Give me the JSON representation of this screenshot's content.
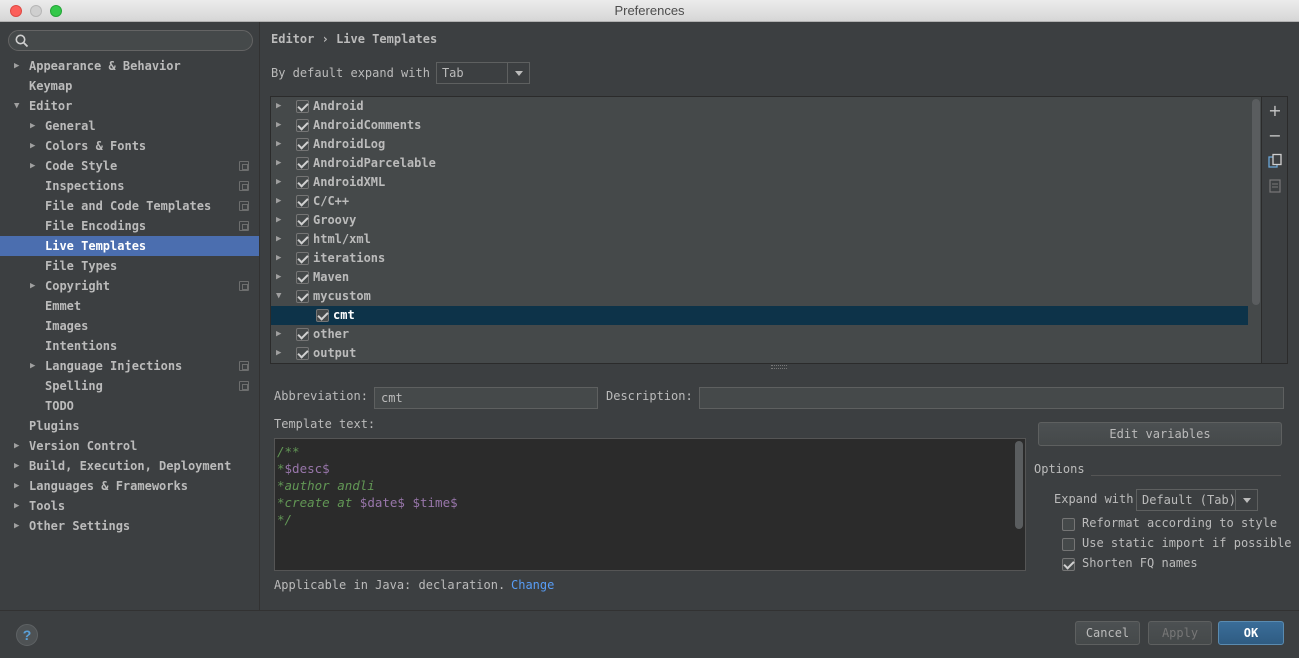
{
  "window": {
    "title": "Preferences"
  },
  "search": {
    "placeholder": ""
  },
  "sidebar": {
    "items": [
      {
        "label": "Appearance & Behavior",
        "indent": 0,
        "arrow": "right",
        "proj": false,
        "selected": false
      },
      {
        "label": "Keymap",
        "indent": 0,
        "arrow": "",
        "proj": false,
        "selected": false
      },
      {
        "label": "Editor",
        "indent": 0,
        "arrow": "down",
        "proj": false,
        "selected": false
      },
      {
        "label": "General",
        "indent": 1,
        "arrow": "right",
        "proj": false,
        "selected": false
      },
      {
        "label": "Colors & Fonts",
        "indent": 1,
        "arrow": "right",
        "proj": false,
        "selected": false
      },
      {
        "label": "Code Style",
        "indent": 1,
        "arrow": "right",
        "proj": true,
        "selected": false
      },
      {
        "label": "Inspections",
        "indent": 1,
        "arrow": "",
        "proj": true,
        "selected": false
      },
      {
        "label": "File and Code Templates",
        "indent": 1,
        "arrow": "",
        "proj": true,
        "selected": false
      },
      {
        "label": "File Encodings",
        "indent": 1,
        "arrow": "",
        "proj": true,
        "selected": false
      },
      {
        "label": "Live Templates",
        "indent": 1,
        "arrow": "",
        "proj": false,
        "selected": true
      },
      {
        "label": "File Types",
        "indent": 1,
        "arrow": "",
        "proj": false,
        "selected": false
      },
      {
        "label": "Copyright",
        "indent": 1,
        "arrow": "right",
        "proj": true,
        "selected": false
      },
      {
        "label": "Emmet",
        "indent": 1,
        "arrow": "",
        "proj": false,
        "selected": false
      },
      {
        "label": "Images",
        "indent": 1,
        "arrow": "",
        "proj": false,
        "selected": false
      },
      {
        "label": "Intentions",
        "indent": 1,
        "arrow": "",
        "proj": false,
        "selected": false
      },
      {
        "label": "Language Injections",
        "indent": 1,
        "arrow": "right",
        "proj": true,
        "selected": false
      },
      {
        "label": "Spelling",
        "indent": 1,
        "arrow": "",
        "proj": true,
        "selected": false
      },
      {
        "label": "TODO",
        "indent": 1,
        "arrow": "",
        "proj": false,
        "selected": false
      },
      {
        "label": "Plugins",
        "indent": 0,
        "arrow": "",
        "proj": false,
        "selected": false
      },
      {
        "label": "Version Control",
        "indent": 0,
        "arrow": "right",
        "proj": false,
        "selected": false
      },
      {
        "label": "Build, Execution, Deployment",
        "indent": 0,
        "arrow": "right",
        "proj": false,
        "selected": false
      },
      {
        "label": "Languages & Frameworks",
        "indent": 0,
        "arrow": "right",
        "proj": false,
        "selected": false
      },
      {
        "label": "Tools",
        "indent": 0,
        "arrow": "right",
        "proj": false,
        "selected": false
      },
      {
        "label": "Other Settings",
        "indent": 0,
        "arrow": "right",
        "proj": false,
        "selected": false
      }
    ]
  },
  "breadcrumb": {
    "parent": "Editor",
    "separator": "›",
    "current": "Live Templates"
  },
  "expand": {
    "label": "By default expand with",
    "value": "Tab"
  },
  "templates": [
    {
      "name": "Android",
      "level": 0,
      "arrow": "right",
      "checked": true,
      "selected": false
    },
    {
      "name": "AndroidComments",
      "level": 0,
      "arrow": "right",
      "checked": true,
      "selected": false
    },
    {
      "name": "AndroidLog",
      "level": 0,
      "arrow": "right",
      "checked": true,
      "selected": false
    },
    {
      "name": "AndroidParcelable",
      "level": 0,
      "arrow": "right",
      "checked": true,
      "selected": false
    },
    {
      "name": "AndroidXML",
      "level": 0,
      "arrow": "right",
      "checked": true,
      "selected": false
    },
    {
      "name": "C/C++",
      "level": 0,
      "arrow": "right",
      "checked": true,
      "selected": false
    },
    {
      "name": "Groovy",
      "level": 0,
      "arrow": "right",
      "checked": true,
      "selected": false
    },
    {
      "name": "html/xml",
      "level": 0,
      "arrow": "right",
      "checked": true,
      "selected": false
    },
    {
      "name": "iterations",
      "level": 0,
      "arrow": "right",
      "checked": true,
      "selected": false
    },
    {
      "name": "Maven",
      "level": 0,
      "arrow": "right",
      "checked": true,
      "selected": false
    },
    {
      "name": "mycustom",
      "level": 0,
      "arrow": "down",
      "checked": true,
      "selected": false
    },
    {
      "name": "cmt",
      "level": 1,
      "arrow": "",
      "checked": true,
      "selected": true
    },
    {
      "name": "other",
      "level": 0,
      "arrow": "right",
      "checked": true,
      "selected": false
    },
    {
      "name": "output",
      "level": 0,
      "arrow": "right",
      "checked": true,
      "selected": false
    }
  ],
  "toolbar": {
    "add_icon": "plus-icon",
    "remove_icon": "minus-icon",
    "copy_icon": "copy-icon",
    "restore_icon": "restore-icon"
  },
  "form": {
    "abbreviation_label": "Abbreviation:",
    "abbreviation_value": "cmt",
    "description_label": "Description:",
    "description_value": "",
    "template_text_label": "Template text:",
    "template_lines": [
      {
        "text": "/**",
        "vars": []
      },
      {
        "text": "*$desc$",
        "vars": [
          "$desc$"
        ]
      },
      {
        "text": "*author andli",
        "vars": []
      },
      {
        "text": "*create at $date$ $time$",
        "vars": [
          "$date$",
          "$time$"
        ]
      },
      {
        "text": "*/",
        "vars": []
      }
    ],
    "applicable_text": "Applicable in Java: declaration.",
    "change_link": "Change"
  },
  "options": {
    "edit_variables": "Edit variables",
    "title": "Options",
    "expand_with_label": "Expand with",
    "expand_with_value": "Default (Tab)",
    "reformat_label": "Reformat according to style",
    "reformat_checked": false,
    "static_import_label": "Use static import if possible",
    "static_import_checked": false,
    "shorten_fq_label": "Shorten FQ names",
    "shorten_fq_checked": true
  },
  "footer": {
    "help": "?",
    "cancel": "Cancel",
    "apply": "Apply",
    "ok": "OK"
  },
  "colors": {
    "selection_sidebar": "#4b6eaf",
    "selection_list": "#0d3349",
    "link": "#589df6",
    "comment": "#629755",
    "variable": "#9876aa"
  }
}
